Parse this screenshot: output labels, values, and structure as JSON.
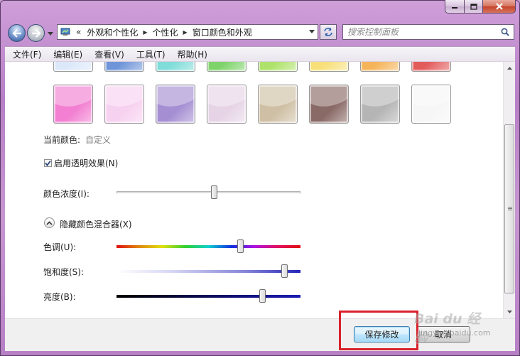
{
  "window": {
    "caption_buttons": [
      "minimize",
      "maximize",
      "close"
    ]
  },
  "address_bar": {
    "overflow": "«",
    "crumbs": [
      "外观和个性化",
      "个性化",
      "窗口颜色和外观"
    ]
  },
  "search": {
    "placeholder": "搜索控制面板"
  },
  "menu": {
    "file": "文件(F)",
    "edit": "编辑(E)",
    "view": "查看(V)",
    "tools": "工具(T)",
    "help": "帮助(H)"
  },
  "palette": {
    "row1_colors": [
      "#dbe8fa",
      "#6f95d8",
      "#7fdcd8",
      "#7ed36a",
      "#aee26b",
      "#f7e07a",
      "#f5b45a",
      "#e35c5c"
    ],
    "row2_colors": [
      "#f27fd1",
      "#f7d1f0",
      "#a58fd2",
      "#e6d4e6",
      "#cfc0a5",
      "#8a6a66",
      "#b5b5b5",
      "#f6f6f6"
    ]
  },
  "current_color": {
    "label": "当前颜色:",
    "value": "自定义"
  },
  "transparency": {
    "label": "启用透明效果(N)",
    "checked": true
  },
  "intensity": {
    "label": "颜色浓度(I):",
    "level_percent": 53
  },
  "mixer_toggle": {
    "label": "隐藏颜色混合器(X)"
  },
  "mixer": {
    "hue": {
      "label": "色调(U):",
      "level_percent": 67
    },
    "saturation": {
      "label": "饱和度(S):",
      "level_percent": 91
    },
    "brightness": {
      "label": "亮度(B):",
      "level_percent": 79
    }
  },
  "buttons": {
    "save": "保存修改",
    "cancel": "取消"
  },
  "watermark": {
    "brand": "Bai du 经验",
    "url": "jingyan.baidu.com"
  },
  "colors": {
    "highlight_border": "#d9212a",
    "window_frame": "#b77fc6",
    "primary_button": "#bee6fd"
  }
}
